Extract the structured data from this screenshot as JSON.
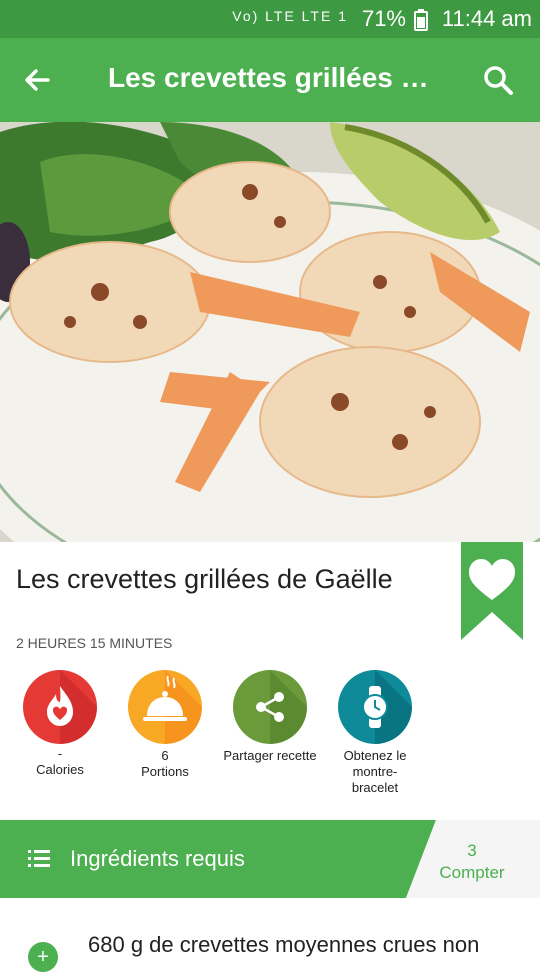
{
  "status_bar": {
    "network_labels": "Vo) LTE  LTE 1",
    "battery_percent": "71%",
    "time": "11:44 am"
  },
  "app_bar": {
    "title": "Les crevettes grillées d…"
  },
  "recipe": {
    "title": "Les crevettes grillées de Gaëlle",
    "duration": "2 HEURES 15 MINUTES"
  },
  "actions": [
    {
      "value": "-",
      "label": "Calories",
      "color": "#e53935"
    },
    {
      "value": "6",
      "label": "Portions",
      "color": "#f9a825"
    },
    {
      "value": "",
      "label": "Partager recette",
      "color": "#6a9a3a"
    },
    {
      "value": "",
      "label": "Obtenez le montre-bracelet",
      "color": "#0e8a99"
    }
  ],
  "ingredients_header": {
    "title": "Ingrédients requis",
    "count_value": "3",
    "count_label": "Compter"
  },
  "ingredients": [
    {
      "text": "680 g de crevettes moyennes crues non"
    }
  ],
  "colors": {
    "primary": "#4caf50",
    "primary_dark": "#3e9a42"
  }
}
